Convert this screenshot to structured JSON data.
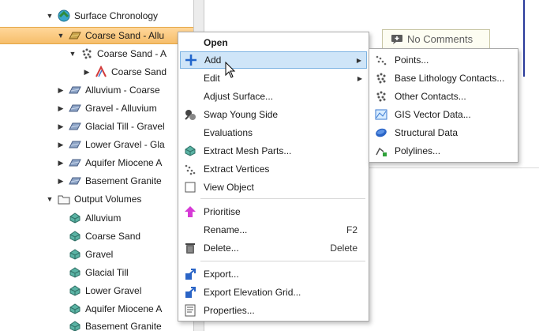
{
  "tree": {
    "items": [
      {
        "label": "Surface Chronology",
        "arrow": "▼",
        "icon": "chronology-icon"
      },
      {
        "label": "Coarse Sand - Allu",
        "arrow": "▼",
        "icon": "surface-icon"
      },
      {
        "label": "Coarse Sand - A",
        "arrow": "▼",
        "icon": "contacts-icon"
      },
      {
        "label": "Coarse Sand",
        "arrow": "▶",
        "icon": "polyline-icon"
      },
      {
        "label": "Alluvium - Coarse",
        "arrow": "▶",
        "icon": "surface-icon"
      },
      {
        "label": "Gravel - Alluvium",
        "arrow": "▶",
        "icon": "surface-icon"
      },
      {
        "label": "Glacial Till - Gravel",
        "arrow": "▶",
        "icon": "surface-icon"
      },
      {
        "label": "Lower Gravel - Gla",
        "arrow": "▶",
        "icon": "surface-icon"
      },
      {
        "label": "Aquifer Miocene A",
        "arrow": "▶",
        "icon": "surface-icon"
      },
      {
        "label": "Basement Granite",
        "arrow": "▶",
        "icon": "surface-icon"
      },
      {
        "label": "Output Volumes",
        "arrow": "▼",
        "icon": "folder-icon"
      },
      {
        "label": "Alluvium",
        "arrow": "",
        "icon": "volume-icon"
      },
      {
        "label": "Coarse Sand",
        "arrow": "",
        "icon": "volume-icon"
      },
      {
        "label": "Gravel",
        "arrow": "",
        "icon": "volume-icon"
      },
      {
        "label": "Glacial Till",
        "arrow": "",
        "icon": "volume-icon"
      },
      {
        "label": "Lower Gravel",
        "arrow": "",
        "icon": "volume-icon"
      },
      {
        "label": "Aquifer Miocene A",
        "arrow": "",
        "icon": "volume-icon"
      },
      {
        "label": "Basement Granite",
        "arrow": "",
        "icon": "volume-icon"
      }
    ]
  },
  "comments": {
    "label": "No Comments",
    "icon": "comment-icon"
  },
  "context_menu": {
    "items": [
      {
        "label": "Open",
        "icon": "",
        "shortcut": "",
        "submenu": false
      },
      {
        "label": "Add",
        "icon": "add-icon",
        "shortcut": "",
        "submenu": true
      },
      {
        "label": "Edit",
        "icon": "",
        "shortcut": "",
        "submenu": true
      },
      {
        "label": "Adjust Surface...",
        "icon": "",
        "shortcut": "",
        "submenu": false
      },
      {
        "label": "Swap Young Side",
        "icon": "swap-icon",
        "shortcut": "",
        "submenu": false
      },
      {
        "label": "Evaluations",
        "icon": "",
        "shortcut": "",
        "submenu": false
      },
      {
        "label": "Extract Mesh Parts...",
        "icon": "mesh-icon",
        "shortcut": "",
        "submenu": false
      },
      {
        "label": "Extract Vertices",
        "icon": "vertices-icon",
        "shortcut": "",
        "submenu": false
      },
      {
        "label": "View Object",
        "icon": "checkbox-icon",
        "shortcut": "",
        "submenu": false
      },
      {
        "label": "Prioritise",
        "icon": "priority-icon",
        "shortcut": "",
        "submenu": false
      },
      {
        "label": "Rename...",
        "icon": "",
        "shortcut": "F2",
        "submenu": false
      },
      {
        "label": "Delete...",
        "icon": "trash-icon",
        "shortcut": "Delete",
        "submenu": false
      },
      {
        "label": "Export...",
        "icon": "export-icon",
        "shortcut": "",
        "submenu": false
      },
      {
        "label": "Export Elevation Grid...",
        "icon": "export-icon",
        "shortcut": "",
        "submenu": false
      },
      {
        "label": "Properties...",
        "icon": "properties-icon",
        "shortcut": "",
        "submenu": false
      }
    ]
  },
  "sub_menu": {
    "items": [
      {
        "label": "Points...",
        "icon": "points-icon"
      },
      {
        "label": "Base Lithology Contacts...",
        "icon": "contacts-icon"
      },
      {
        "label": "Other Contacts...",
        "icon": "contacts-icon"
      },
      {
        "label": "GIS Vector Data...",
        "icon": "gis-icon"
      },
      {
        "label": "Structural Data",
        "icon": "structural-icon"
      },
      {
        "label": "Polylines...",
        "icon": "polylines-icon"
      }
    ]
  },
  "colors": {
    "selection": "#f6be6b",
    "menu_hover": "#cfe5f8",
    "accent_line": "#2a3a9a"
  }
}
